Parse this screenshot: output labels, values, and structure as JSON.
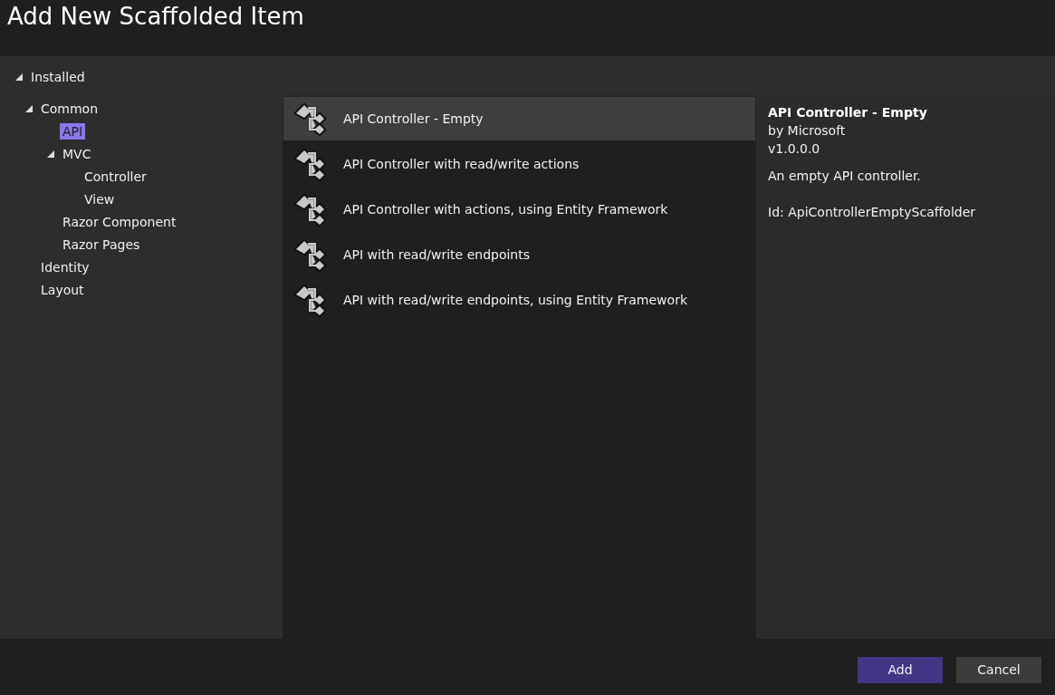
{
  "window": {
    "title": "Add New Scaffolded Item"
  },
  "tree": {
    "label": "Installed",
    "expanded": true,
    "selected": false,
    "children": [
      {
        "label": "Common",
        "expanded": true,
        "selected": false,
        "children": [
          {
            "label": "API",
            "selected": true
          },
          {
            "label": "MVC",
            "expanded": true,
            "selected": false,
            "children": [
              {
                "label": "Controller",
                "selected": false
              },
              {
                "label": "View",
                "selected": false
              }
            ]
          },
          {
            "label": "Razor Component",
            "selected": false
          },
          {
            "label": "Razor Pages",
            "selected": false
          }
        ]
      },
      {
        "label": "Identity",
        "selected": false
      },
      {
        "label": "Layout",
        "selected": false
      }
    ]
  },
  "templates": [
    {
      "name": "API Controller - Empty",
      "selected": true
    },
    {
      "name": "API Controller with read/write actions",
      "selected": false
    },
    {
      "name": "API Controller with actions, using Entity Framework",
      "selected": false
    },
    {
      "name": "API with read/write endpoints",
      "selected": false
    },
    {
      "name": "API with read/write endpoints, using Entity Framework",
      "selected": false
    }
  ],
  "details": {
    "title": "API Controller - Empty",
    "author": "by Microsoft",
    "version": "v1.0.0.0",
    "description": "An empty API controller.",
    "id": "Id: ApiControllerEmptyScaffolder"
  },
  "buttons": [
    {
      "label": "Add",
      "kind": "primary"
    },
    {
      "label": "Cancel",
      "kind": "secondary"
    }
  ]
}
